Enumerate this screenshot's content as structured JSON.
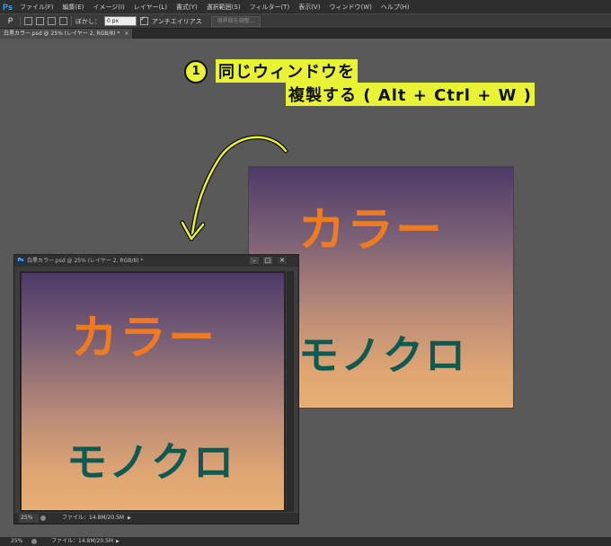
{
  "app": {
    "logo": "Ps",
    "menu": [
      "ファイル(F)",
      "編集(E)",
      "イメージ(I)",
      "レイヤー(L)",
      "書式(Y)",
      "選択範囲(S)",
      "フィルター(T)",
      "表示(V)",
      "ウィンドウ(W)",
      "ヘルプ(H)"
    ]
  },
  "options": {
    "tool_icon": "lasso-icon",
    "feather_label": "ぼかし：",
    "feather_value": "0 px",
    "antialias_label": "アンチエイリアス",
    "antialias_checked": true,
    "refine_edge_label": "境界線を調整..."
  },
  "document_tab": {
    "label": "白黒カラー.psd @ 25% (レイヤー 2, RGB/8) *",
    "close": "×"
  },
  "canvas": {
    "text_color": "カラー",
    "text_mono": "モノクロ",
    "gradient_top": "#4d3a69",
    "gradient_bottom": "#e8ae74",
    "color_text_color": "#f07a22",
    "mono_text_color": "#0c5a52"
  },
  "float_window": {
    "ps_icon": "Ps",
    "title": "白黒カラー.psd @ 25% (レイヤー 2, RGB/8) *",
    "minimize": "–",
    "maximize": "□",
    "close": "✕",
    "zoom": "25%",
    "file_info": "ファイル：14.8M/20.5M",
    "arrow": "▶"
  },
  "statusbar": {
    "zoom": "25%",
    "file_info": "ファイル：14.8M/20.5M",
    "arrow": "▶"
  },
  "annotation": {
    "number": "1",
    "line1": "同じウィンドウを",
    "line2": "複製する ( Alt + Ctrl + W )",
    "highlight_color": "#e9f335"
  }
}
